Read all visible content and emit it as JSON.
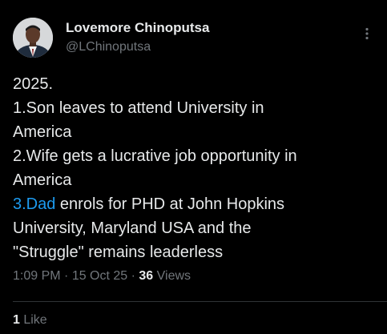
{
  "author": {
    "display_name": "Lovemore Chinoputsa",
    "handle": "@LChinoputsa",
    "avatar_icon": "profile-photo"
  },
  "more_icon": "more-vertical-icon",
  "tweet": {
    "lines": [
      "2025.",
      "1.Son leaves to attend University in",
      "America",
      "2.Wife gets a lucrative job opportunity in",
      "America",
      "",
      "University, Maryland USA and the",
      "\"Struggle\" remains leaderless"
    ],
    "line6_link": "3.Dad",
    "line6_rest": " enrols for PHD at John Hopkins"
  },
  "meta": {
    "time": "1:09 PM",
    "separator": " · ",
    "date": "15 Oct 25",
    "views_count": "36",
    "views_label": " Views"
  },
  "likes": {
    "count": "1",
    "label": " Like"
  },
  "colors": {
    "background": "#000000",
    "text": "#e7e9ea",
    "secondary": "#71767b",
    "link": "#1d9bf0",
    "divider": "#2f3336"
  }
}
